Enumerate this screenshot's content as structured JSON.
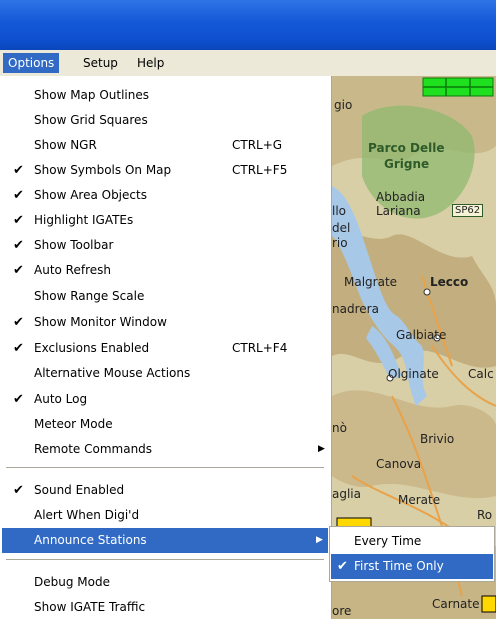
{
  "menubar": {
    "items": [
      {
        "label": "Options"
      },
      {
        "label": "Setup"
      },
      {
        "label": "Help"
      }
    ]
  },
  "options_menu": {
    "items": [
      {
        "label": "Show Map Outlines",
        "checked": false,
        "shortcut": ""
      },
      {
        "label": "Show Grid Squares",
        "checked": false,
        "shortcut": ""
      },
      {
        "label": "Show NGR",
        "checked": false,
        "shortcut": "CTRL+G"
      },
      {
        "label": "Show Symbols On Map",
        "checked": true,
        "shortcut": "CTRL+F5"
      },
      {
        "label": "Show Area Objects",
        "checked": true,
        "shortcut": ""
      },
      {
        "label": "Highlight IGATEs",
        "checked": true,
        "shortcut": ""
      },
      {
        "label": "Show Toolbar",
        "checked": true,
        "shortcut": ""
      },
      {
        "label": "Auto Refresh",
        "checked": true,
        "shortcut": ""
      },
      {
        "label": "Show Range Scale",
        "checked": false,
        "shortcut": ""
      },
      {
        "label": "Show Monitor Window",
        "checked": true,
        "shortcut": ""
      },
      {
        "label": "Exclusions Enabled",
        "checked": true,
        "shortcut": "CTRL+F4"
      },
      {
        "label": "Alternative Mouse Actions",
        "checked": false,
        "shortcut": ""
      },
      {
        "label": "Auto Log",
        "checked": true,
        "shortcut": ""
      },
      {
        "label": "Meteor Mode",
        "checked": false,
        "shortcut": ""
      },
      {
        "label": "Remote Commands",
        "checked": false,
        "shortcut": "",
        "submenu": true
      },
      {
        "label": "Sound Enabled",
        "checked": true,
        "shortcut": ""
      },
      {
        "label": "Alert When Digi'd",
        "checked": false,
        "shortcut": ""
      },
      {
        "label": "Announce Stations",
        "checked": false,
        "shortcut": "",
        "submenu": true,
        "highlighted": true
      },
      {
        "label": "Debug Mode",
        "checked": false,
        "shortcut": ""
      },
      {
        "label": "Show IGATE Traffic",
        "checked": false,
        "shortcut": ""
      }
    ],
    "check_glyph": "✔",
    "submenu_glyph": "▶"
  },
  "announce_submenu": {
    "items": [
      {
        "label": "Every Time",
        "checked": false
      },
      {
        "label": "First Time Only",
        "checked": true,
        "highlighted": true
      }
    ]
  },
  "map": {
    "labels": [
      {
        "text": "gio"
      },
      {
        "text": "Parco Delle"
      },
      {
        "text": "Grigne"
      },
      {
        "text": "Abbadia"
      },
      {
        "text": "Lariana"
      },
      {
        "text": "SP62"
      },
      {
        "text": "llo"
      },
      {
        "text": "del"
      },
      {
        "text": "rio"
      },
      {
        "text": "Malgrate"
      },
      {
        "text": "Lecco"
      },
      {
        "text": "nadrera"
      },
      {
        "text": "Galbiate"
      },
      {
        "text": "Olginate"
      },
      {
        "text": "Calc"
      },
      {
        "text": "Brivio"
      },
      {
        "text": "nò"
      },
      {
        "text": "Canova"
      },
      {
        "text": "aglia"
      },
      {
        "text": "Merate"
      },
      {
        "text": "Ro"
      },
      {
        "text": "Carnate"
      },
      {
        "text": "ore"
      }
    ],
    "colors": {
      "land": "#d9cfa6",
      "hills": "#b9a77a",
      "park": "#8fb96f",
      "lake": "#a8c8e8",
      "road": "#e8a24a",
      "green_box": "#1fe01f"
    }
  }
}
